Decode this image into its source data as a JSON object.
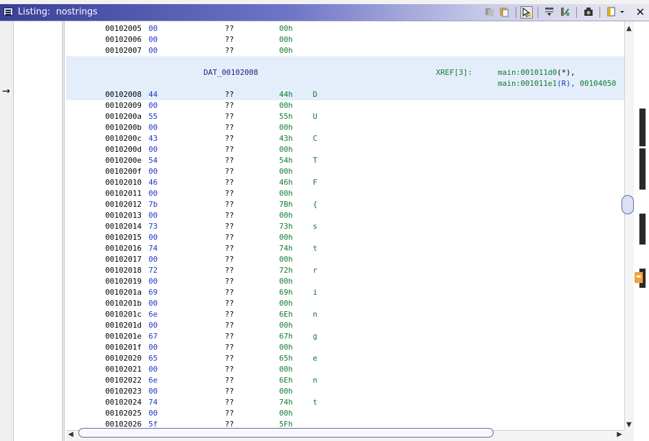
{
  "window": {
    "title": "Listing:  nostrings",
    "close_glyph": "✕",
    "toolbar_icons": [
      "copy-icon",
      "paste-icon",
      "cursor-select-icon",
      "field-navigate-icon",
      "diff-icon",
      "snapshot-icon",
      "format-icon",
      "dropdown-icon"
    ]
  },
  "label": {
    "name": "DAT_00102008",
    "xref_label": "XREF[3]:",
    "xref_line1": {
      "func": "main:001011d0",
      "mark": "(*),"
    },
    "xref_line2": {
      "func": "main:001011e1",
      "mark": "(R),",
      "extra": "00104050"
    }
  },
  "rows_top": [
    {
      "addr": "00102005",
      "byte": "00",
      "qq": "??",
      "val": "00h",
      "ch": ""
    },
    {
      "addr": "00102006",
      "byte": "00",
      "qq": "??",
      "val": "00h",
      "ch": ""
    },
    {
      "addr": "00102007",
      "byte": "00",
      "qq": "??",
      "val": "00h",
      "ch": ""
    }
  ],
  "rows": [
    {
      "addr": "00102008",
      "byte": "44",
      "qq": "??",
      "val": "44h",
      "ch": "D"
    },
    {
      "addr": "00102009",
      "byte": "00",
      "qq": "??",
      "val": "00h",
      "ch": ""
    },
    {
      "addr": "0010200a",
      "byte": "55",
      "qq": "??",
      "val": "55h",
      "ch": "U"
    },
    {
      "addr": "0010200b",
      "byte": "00",
      "qq": "??",
      "val": "00h",
      "ch": ""
    },
    {
      "addr": "0010200c",
      "byte": "43",
      "qq": "??",
      "val": "43h",
      "ch": "C"
    },
    {
      "addr": "0010200d",
      "byte": "00",
      "qq": "??",
      "val": "00h",
      "ch": ""
    },
    {
      "addr": "0010200e",
      "byte": "54",
      "qq": "??",
      "val": "54h",
      "ch": "T"
    },
    {
      "addr": "0010200f",
      "byte": "00",
      "qq": "??",
      "val": "00h",
      "ch": ""
    },
    {
      "addr": "00102010",
      "byte": "46",
      "qq": "??",
      "val": "46h",
      "ch": "F"
    },
    {
      "addr": "00102011",
      "byte": "00",
      "qq": "??",
      "val": "00h",
      "ch": ""
    },
    {
      "addr": "00102012",
      "byte": "7b",
      "qq": "??",
      "val": "7Bh",
      "ch": "{"
    },
    {
      "addr": "00102013",
      "byte": "00",
      "qq": "??",
      "val": "00h",
      "ch": ""
    },
    {
      "addr": "00102014",
      "byte": "73",
      "qq": "??",
      "val": "73h",
      "ch": "s"
    },
    {
      "addr": "00102015",
      "byte": "00",
      "qq": "??",
      "val": "00h",
      "ch": ""
    },
    {
      "addr": "00102016",
      "byte": "74",
      "qq": "??",
      "val": "74h",
      "ch": "t"
    },
    {
      "addr": "00102017",
      "byte": "00",
      "qq": "??",
      "val": "00h",
      "ch": ""
    },
    {
      "addr": "00102018",
      "byte": "72",
      "qq": "??",
      "val": "72h",
      "ch": "r"
    },
    {
      "addr": "00102019",
      "byte": "00",
      "qq": "??",
      "val": "00h",
      "ch": ""
    },
    {
      "addr": "0010201a",
      "byte": "69",
      "qq": "??",
      "val": "69h",
      "ch": "i"
    },
    {
      "addr": "0010201b",
      "byte": "00",
      "qq": "??",
      "val": "00h",
      "ch": ""
    },
    {
      "addr": "0010201c",
      "byte": "6e",
      "qq": "??",
      "val": "6Eh",
      "ch": "n"
    },
    {
      "addr": "0010201d",
      "byte": "00",
      "qq": "??",
      "val": "00h",
      "ch": ""
    },
    {
      "addr": "0010201e",
      "byte": "67",
      "qq": "??",
      "val": "67h",
      "ch": "g"
    },
    {
      "addr": "0010201f",
      "byte": "00",
      "qq": "??",
      "val": "00h",
      "ch": ""
    },
    {
      "addr": "00102020",
      "byte": "65",
      "qq": "??",
      "val": "65h",
      "ch": "e"
    },
    {
      "addr": "00102021",
      "byte": "00",
      "qq": "??",
      "val": "00h",
      "ch": ""
    },
    {
      "addr": "00102022",
      "byte": "6e",
      "qq": "??",
      "val": "6Eh",
      "ch": "n"
    },
    {
      "addr": "00102023",
      "byte": "00",
      "qq": "??",
      "val": "00h",
      "ch": ""
    },
    {
      "addr": "00102024",
      "byte": "74",
      "qq": "??",
      "val": "74h",
      "ch": "t"
    },
    {
      "addr": "00102025",
      "byte": "00",
      "qq": "??",
      "val": "00h",
      "ch": ""
    },
    {
      "addr": "00102026",
      "byte": "5f",
      "qq": "??",
      "val": "5Fh",
      "ch": "_"
    }
  ]
}
